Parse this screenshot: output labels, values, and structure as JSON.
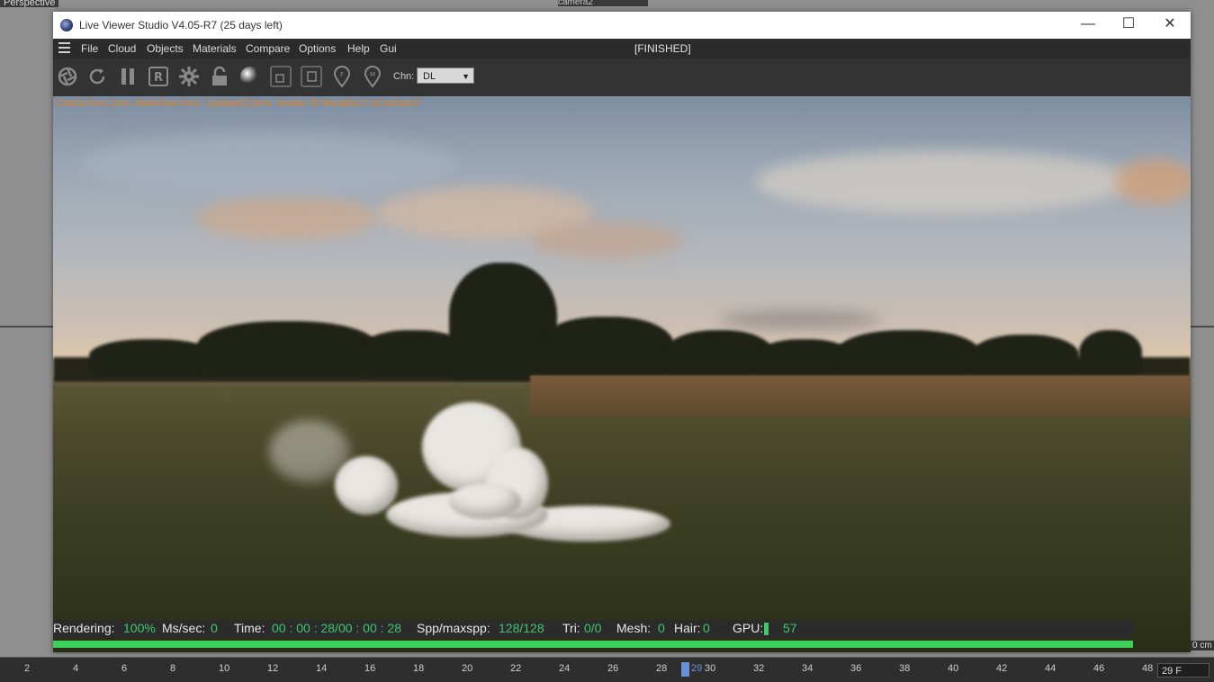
{
  "viewport": {
    "view_name": "Perspective",
    "camera_name": "camera2",
    "unit_label": "0 cm"
  },
  "window": {
    "title": "Live Viewer Studio V4.05-R7 (25 days left)",
    "controls": {
      "minimize": "—",
      "maximize": "☐",
      "close": "✕"
    }
  },
  "menu": {
    "items": [
      "File",
      "Cloud",
      "Objects",
      "Materials",
      "Compare",
      "Options",
      "Help",
      "Gui"
    ],
    "render_state": "[FINISHED]"
  },
  "toolbar": {
    "icons": [
      "aperture-icon",
      "refresh-icon",
      "pause-icon",
      "region-render-icon",
      "settings-gear-icon",
      "lock-icon",
      "material-sphere-icon",
      "frame-icon",
      "frame-icon-2",
      "focus-pin-icon",
      "material-pin-icon"
    ],
    "channel_label": "Chn:",
    "channel_value": "DL"
  },
  "debug_line": "Check:0ms./1ms. MeshGen:0ms. Update[C]:0ms. Nodes:79 Movable:0 txCached:0",
  "status": {
    "rendering_label": "Rendering:",
    "rendering_value": "100%",
    "mssec_label": "Ms/sec:",
    "mssec_value": "0",
    "time_label": "Time:",
    "time_value": "00 : 00 : 28/00 : 00 : 28",
    "spp_label": "Spp/maxspp:",
    "spp_value": "128/128",
    "tri_label": "Tri:",
    "tri_value": "0/0",
    "mesh_label": "Mesh:",
    "mesh_value": "0",
    "hair_label": "Hair:",
    "hair_value": "0",
    "gpu_label": "GPU:",
    "gpu_value": "57",
    "progress_fraction": 1.0,
    "accent_color": "#3fc86a"
  },
  "timeline": {
    "ticks": [
      "2",
      "4",
      "6",
      "8",
      "10",
      "12",
      "14",
      "16",
      "18",
      "20",
      "22",
      "24",
      "26",
      "28",
      "29",
      "30",
      "32",
      "34",
      "36",
      "38",
      "40",
      "42",
      "44",
      "46",
      "48"
    ],
    "current_frame": "29",
    "frame_field": "29 F"
  }
}
